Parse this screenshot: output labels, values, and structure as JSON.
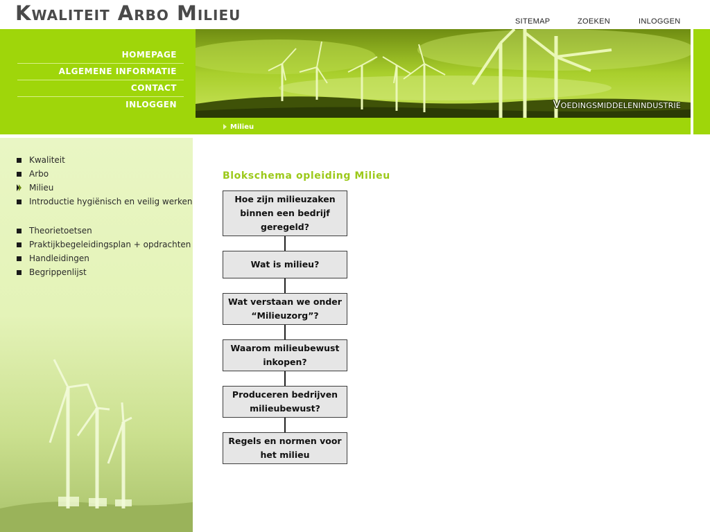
{
  "header": {
    "site_title": "Kwaliteit Arbo Milieu",
    "top_links": [
      "SITEMAP",
      "ZOEKEN",
      "INLOGGEN"
    ]
  },
  "main_nav": [
    "HOMEPAGE",
    "ALGEMENE INFORMATIE",
    "CONTACT",
    "INLOGGEN"
  ],
  "banner": {
    "caption": "Voedingsmiddelenindustrie"
  },
  "breadcrumb": {
    "current": "Milieu"
  },
  "sidebar": {
    "group1": [
      "Kwaliteit",
      "Arbo",
      "Milieu",
      "Introductie hygiënisch en veilig werken"
    ],
    "group2": [
      "Theorietoetsen",
      "Praktijkbegeleidingsplan + opdrachten",
      "Handleidingen",
      "Begrippenlijst"
    ],
    "active": "Milieu"
  },
  "flowchart": {
    "title": "Blokschema opleiding Milieu",
    "steps": [
      "Hoe zijn milieuzaken binnen een bedrijf geregeld?",
      "Wat is milieu?",
      "Wat verstaan we onder “Milieuzorg”?",
      "Waarom milieubewust inkopen?",
      "Produceren bedrijven milieubewust?",
      "Regels en normen voor het milieu"
    ]
  },
  "colors": {
    "accent_green": "#9fd60a",
    "sidebar_bg": "#e9f6c4",
    "title_green": "#9cc91a",
    "box_bg": "#e6e6e6"
  }
}
